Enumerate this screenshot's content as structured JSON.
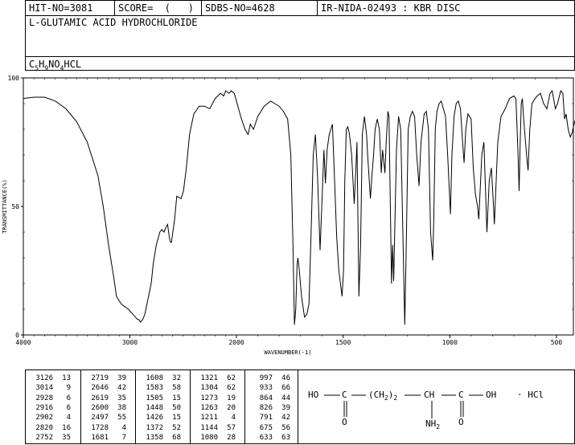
{
  "header": {
    "hit_no": "HIT-NO=3081",
    "score": "SCORE=  (   )",
    "sdbs_no": "SDBS-NO=4628",
    "source": "IR-NIDA-02493 : KBR DISC",
    "compound": "L-GLUTAMIC ACID HYDROCHLORIDE",
    "formula": {
      "c": "C",
      "c_n": "5",
      "h": "H",
      "h_n": "9",
      "n": "NO",
      "o_n": "4",
      "rest": "HCL"
    }
  },
  "chart_data": {
    "type": "line",
    "title": "",
    "xlabel": "WAVENUMBER(-1)",
    "ylabel": "TRANSMITTANCE(%)",
    "xlim": [
      4000,
      400
    ],
    "ylim": [
      0,
      100
    ],
    "x_ticks": [
      "4000",
      "3000",
      "2000",
      "1500",
      "1000",
      "500"
    ],
    "y_ticks": [
      "0",
      "50",
      "100"
    ],
    "x_tick_values": [
      4000,
      3000,
      2000,
      1500,
      1000,
      500
    ],
    "y_tick_values": [
      0,
      50,
      100
    ],
    "grid": false,
    "series": [
      {
        "values": [
          [
            4000,
            92
          ],
          [
            3900,
            92.5
          ],
          [
            3800,
            92.5
          ],
          [
            3700,
            91
          ],
          [
            3600,
            88
          ],
          [
            3500,
            83
          ],
          [
            3400,
            75
          ],
          [
            3300,
            62
          ],
          [
            3250,
            50
          ],
          [
            3200,
            35
          ],
          [
            3150,
            22
          ],
          [
            3126,
            15
          ],
          [
            3080,
            12
          ],
          [
            3014,
            10
          ],
          [
            2970,
            8
          ],
          [
            2928,
            6
          ],
          [
            2916,
            6
          ],
          [
            2902,
            5
          ],
          [
            2880,
            6
          ],
          [
            2860,
            8
          ],
          [
            2840,
            12
          ],
          [
            2820,
            16
          ],
          [
            2800,
            20
          ],
          [
            2780,
            28
          ],
          [
            2752,
            35
          ],
          [
            2719,
            40
          ],
          [
            2700,
            41
          ],
          [
            2680,
            40
          ],
          [
            2660,
            42
          ],
          [
            2646,
            43
          ],
          [
            2630,
            38
          ],
          [
            2619,
            36
          ],
          [
            2610,
            36
          ],
          [
            2600,
            39
          ],
          [
            2580,
            45
          ],
          [
            2560,
            54
          ],
          [
            2520,
            53
          ],
          [
            2497,
            56
          ],
          [
            2470,
            65
          ],
          [
            2440,
            78
          ],
          [
            2400,
            86
          ],
          [
            2350,
            89
          ],
          [
            2300,
            89
          ],
          [
            2250,
            88
          ],
          [
            2200,
            92
          ],
          [
            2150,
            94
          ],
          [
            2120,
            93
          ],
          [
            2100,
            95
          ],
          [
            2070,
            94
          ],
          [
            2050,
            95
          ],
          [
            2020,
            94
          ],
          [
            2000,
            91
          ],
          [
            1980,
            85
          ],
          [
            1960,
            80
          ],
          [
            1945,
            78
          ],
          [
            1935,
            82
          ],
          [
            1920,
            80
          ],
          [
            1900,
            85
          ],
          [
            1870,
            89
          ],
          [
            1840,
            91
          ],
          [
            1820,
            90
          ],
          [
            1800,
            89
          ],
          [
            1780,
            87
          ],
          [
            1760,
            84
          ],
          [
            1745,
            70
          ],
          [
            1735,
            35
          ],
          [
            1728,
            4
          ],
          [
            1722,
            10
          ],
          [
            1716,
            27
          ],
          [
            1712,
            30
          ],
          [
            1705,
            25
          ],
          [
            1695,
            15
          ],
          [
            1681,
            7
          ],
          [
            1670,
            8
          ],
          [
            1660,
            12
          ],
          [
            1650,
            40
          ],
          [
            1640,
            70
          ],
          [
            1630,
            78
          ],
          [
            1620,
            62
          ],
          [
            1608,
            33
          ],
          [
            1600,
            50
          ],
          [
            1590,
            72
          ],
          [
            1583,
            59
          ],
          [
            1575,
            72
          ],
          [
            1565,
            78
          ],
          [
            1550,
            82
          ],
          [
            1540,
            60
          ],
          [
            1530,
            38
          ],
          [
            1520,
            25
          ],
          [
            1505,
            15
          ],
          [
            1498,
            25
          ],
          [
            1492,
            60
          ],
          [
            1485,
            80
          ],
          [
            1478,
            81
          ],
          [
            1470,
            78
          ],
          [
            1460,
            70
          ],
          [
            1448,
            51
          ],
          [
            1440,
            65
          ],
          [
            1435,
            75
          ],
          [
            1426,
            15
          ],
          [
            1418,
            35
          ],
          [
            1410,
            78
          ],
          [
            1400,
            85
          ],
          [
            1390,
            78
          ],
          [
            1385,
            70
          ],
          [
            1372,
            53
          ],
          [
            1365,
            62
          ],
          [
            1358,
            69
          ],
          [
            1350,
            80
          ],
          [
            1340,
            84
          ],
          [
            1330,
            80
          ],
          [
            1321,
            63
          ],
          [
            1315,
            72
          ],
          [
            1304,
            63
          ],
          [
            1298,
            75
          ],
          [
            1290,
            87
          ],
          [
            1285,
            85
          ],
          [
            1273,
            20
          ],
          [
            1268,
            35
          ],
          [
            1263,
            21
          ],
          [
            1250,
            72
          ],
          [
            1240,
            85
          ],
          [
            1230,
            80
          ],
          [
            1220,
            40
          ],
          [
            1211,
            4
          ],
          [
            1205,
            30
          ],
          [
            1195,
            80
          ],
          [
            1185,
            85
          ],
          [
            1175,
            87
          ],
          [
            1165,
            85
          ],
          [
            1155,
            70
          ],
          [
            1144,
            58
          ],
          [
            1135,
            75
          ],
          [
            1120,
            86
          ],
          [
            1110,
            87
          ],
          [
            1100,
            80
          ],
          [
            1090,
            40
          ],
          [
            1080,
            29
          ],
          [
            1075,
            45
          ],
          [
            1068,
            80
          ],
          [
            1060,
            87
          ],
          [
            1050,
            90
          ],
          [
            1040,
            91
          ],
          [
            1030,
            88
          ],
          [
            1020,
            85
          ],
          [
            1010,
            70
          ],
          [
            997,
            47
          ],
          [
            990,
            70
          ],
          [
            980,
            85
          ],
          [
            970,
            90
          ],
          [
            960,
            91
          ],
          [
            950,
            88
          ],
          [
            940,
            75
          ],
          [
            933,
            67
          ],
          [
            925,
            80
          ],
          [
            915,
            86
          ],
          [
            900,
            84
          ],
          [
            890,
            65
          ],
          [
            880,
            55
          ],
          [
            870,
            50
          ],
          [
            864,
            45
          ],
          [
            860,
            52
          ],
          [
            850,
            70
          ],
          [
            840,
            75
          ],
          [
            826,
            40
          ],
          [
            815,
            60
          ],
          [
            805,
            65
          ],
          [
            795,
            50
          ],
          [
            791,
            43
          ],
          [
            785,
            55
          ],
          [
            775,
            75
          ],
          [
            760,
            85
          ],
          [
            740,
            88
          ],
          [
            720,
            92
          ],
          [
            700,
            93
          ],
          [
            690,
            92
          ],
          [
            680,
            70
          ],
          [
            675,
            56
          ],
          [
            670,
            75
          ],
          [
            665,
            90
          ],
          [
            660,
            92
          ],
          [
            650,
            80
          ],
          [
            640,
            70
          ],
          [
            633,
            64
          ],
          [
            625,
            80
          ],
          [
            615,
            90
          ],
          [
            600,
            92
          ],
          [
            590,
            93
          ],
          [
            575,
            94
          ],
          [
            560,
            90
          ],
          [
            545,
            88
          ],
          [
            530,
            94
          ],
          [
            520,
            95
          ],
          [
            505,
            88
          ],
          [
            495,
            90
          ],
          [
            480,
            95
          ],
          [
            470,
            94
          ],
          [
            462,
            84
          ],
          [
            455,
            86
          ],
          [
            445,
            80
          ],
          [
            435,
            77
          ],
          [
            425,
            79
          ],
          [
            415,
            83
          ],
          [
            400,
            85
          ]
        ]
      }
    ]
  },
  "peaks": {
    "columns": [
      [
        [
          "3126",
          "13"
        ],
        [
          "3014",
          "9"
        ],
        [
          "2928",
          "6"
        ],
        [
          "2916",
          "6"
        ],
        [
          "2902",
          "4"
        ],
        [
          "2820",
          "16"
        ],
        [
          "2752",
          "35"
        ]
      ],
      [
        [
          "2719",
          "39"
        ],
        [
          "2646",
          "42"
        ],
        [
          "2619",
          "35"
        ],
        [
          "2600",
          "38"
        ],
        [
          "2497",
          "55"
        ],
        [
          "1728",
          "4"
        ],
        [
          "1681",
          "7"
        ]
      ],
      [
        [
          "1608",
          "32"
        ],
        [
          "1583",
          "58"
        ],
        [
          "1505",
          "15"
        ],
        [
          "1448",
          "50"
        ],
        [
          "1426",
          "15"
        ],
        [
          "1372",
          "52"
        ],
        [
          "1358",
          "68"
        ]
      ],
      [
        [
          "1321",
          "62"
        ],
        [
          "1304",
          "62"
        ],
        [
          "1273",
          "19"
        ],
        [
          "1263",
          "20"
        ],
        [
          "1211",
          "4"
        ],
        [
          "1144",
          "57"
        ],
        [
          "1080",
          "28"
        ]
      ],
      [
        [
          "997",
          "46"
        ],
        [
          "933",
          "66"
        ],
        [
          "864",
          "44"
        ],
        [
          "826",
          "39"
        ],
        [
          "791",
          "42"
        ],
        [
          "675",
          "56"
        ],
        [
          "633",
          "63"
        ]
      ]
    ]
  },
  "structure": {
    "ho": "HO",
    "c1": "C",
    "ch2": "(CH",
    "ch2_sub": "2",
    "ch2_close": ")",
    "ch2_n": "2",
    "ch": "CH",
    "c2": "C",
    "oh": "OH",
    "hcl": "· HCl",
    "o1": "O",
    "o2": "O",
    "nh2": "NH",
    "nh2_sub": "2"
  }
}
